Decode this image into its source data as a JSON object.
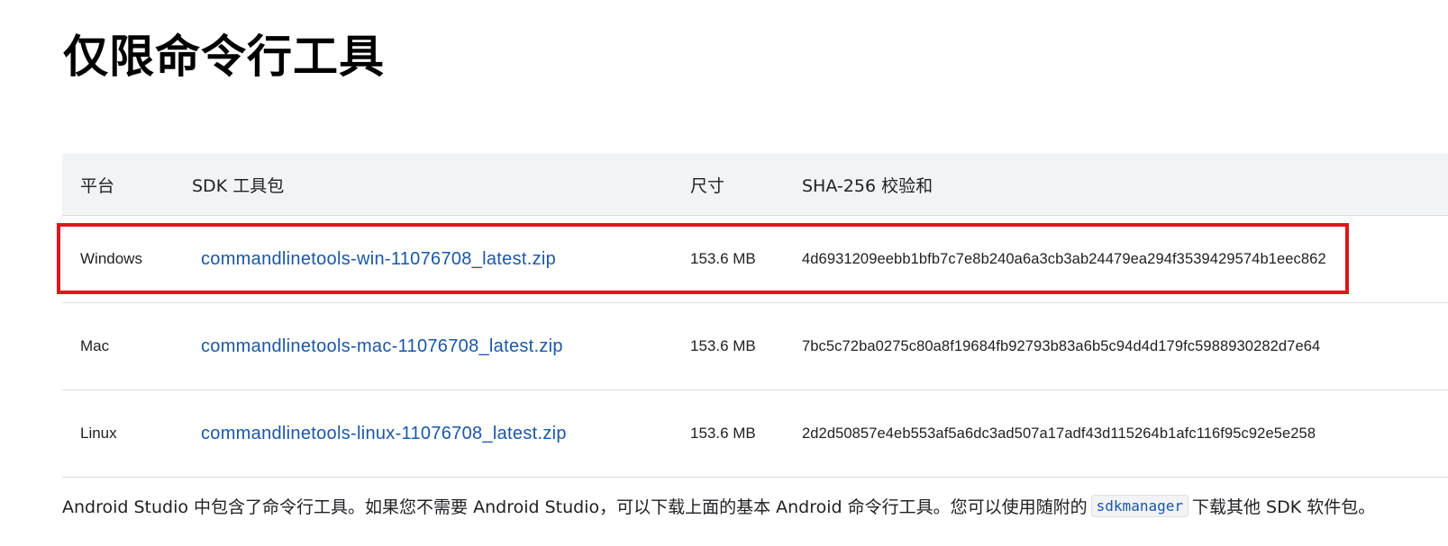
{
  "page": {
    "title": "仅限命令行工具"
  },
  "table": {
    "headers": {
      "platform": "平台",
      "package": "SDK 工具包",
      "size": "尺寸",
      "sha": "SHA-256 校验和"
    },
    "rows": [
      {
        "platform": "Windows",
        "package": "commandlinetools-win-11076708_latest.zip",
        "size": "153.6 MB",
        "sha": "4d6931209eebb1bfb7c7e8b240a6a3cb3ab24479ea294f3539429574b1eec862",
        "highlighted": true
      },
      {
        "platform": "Mac",
        "package": "commandlinetools-mac-11076708_latest.zip",
        "size": "153.6 MB",
        "sha": "7bc5c72ba0275c80a8f19684fb92793b83a6b5c94d4d179fc5988930282d7e64",
        "highlighted": false
      },
      {
        "platform": "Linux",
        "package": "commandlinetools-linux-11076708_latest.zip",
        "size": "153.6 MB",
        "sha": "2d2d50857e4eb553af5a6dc3ad507a17adf43d115264b1afc116f95c92e5e258",
        "highlighted": false
      }
    ]
  },
  "footnote": {
    "before": "Android Studio 中包含了命令行工具。如果您不需要 Android Studio，可以下载上面的基本 Android 命令行工具。您可以使用随附的",
    "code": "sdkmanager",
    "after": "下载其他 SDK 软件包。"
  },
  "colors": {
    "link": "#1a57a8",
    "highlight_border": "#e2141b",
    "header_background": "#f1f3f4"
  }
}
